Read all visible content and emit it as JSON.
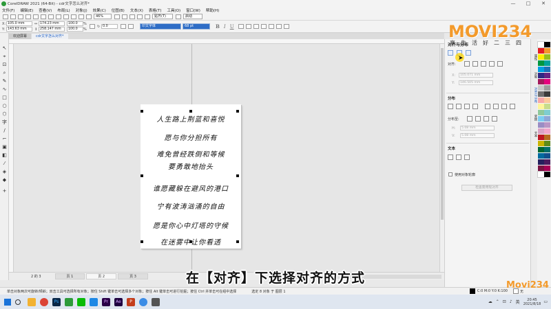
{
  "window": {
    "title": "CorelDRAW 2021 (64-Bit) - cdr文字怎么对齐*",
    "controls": [
      "—",
      "□",
      "✕"
    ]
  },
  "menu": [
    "文件(F)",
    "编辑(E)",
    "查看(V)",
    "布局(L)",
    "对象(J)",
    "效果(C)",
    "位图(B)",
    "文本(X)",
    "表格(T)",
    "工具(O)",
    "窗口(W)",
    "帮助(H)"
  ],
  "toolbar": {
    "zoom": "46%",
    "snap": "贴齐(T)",
    "launch": "启动"
  },
  "propbar": {
    "x": "105.0 mm",
    "y": "143.63 mm",
    "w": "174.23 mm",
    "h": "258.147 mm",
    "sx": "100.0",
    "sy": "100.0",
    "pct": "%",
    "angle": "0.0",
    "font": "印文字体",
    "size": "68 pt",
    "bold": "B",
    "italic": "I",
    "underline": "U"
  },
  "tabs": {
    "welcome": "欢迎屏幕",
    "doc": "cdr文字怎么对齐*"
  },
  "poem": [
    "人生路上荆蓝和喜悦",
    "愿与你分担所有",
    "难免曾经跌倒和等候",
    "要勇敢地抬头",
    "谁愿藏躲在避风的港口",
    "宁有波涛汹涌的自由",
    "愿是你心中灯塔的守候",
    "在迷雾中让你看透"
  ],
  "pages": {
    "counter": "2 的 3",
    "tabs": [
      "页 1",
      "页 2",
      "页 3"
    ],
    "active_index": 1
  },
  "status": {
    "hint": "单击对象两次可旋转/倾斜；双击工具可选择所有对象；按住 Shift 键单击可选择多个对象；按住 Alt 键单击可进行挖掘；按住 Ctrl 并单击可在组中选择",
    "selection": "选定 8 对象 于 图层 1",
    "fill": "C:0 M:0 Y:0 K:100",
    "outline": "无"
  },
  "docker": {
    "title": "对齐与分布",
    "align_to": "对齐:",
    "x_val": "105.071 mm",
    "y_val": "146.505 mm",
    "distribute": "分布",
    "distribute_to": "分布至:",
    "h_val": "5.08 mm",
    "v_val": "5.08 mm",
    "text_section": "文本",
    "use_bbox": "使用对象轮廓",
    "apply_button": "检查需用现对齐"
  },
  "vtabs": [
    "属性",
    "对象",
    "对齐与分布",
    "变换",
    "文本"
  ],
  "palette_colors": [
    "#ffffff",
    "#000000",
    "#e31e24",
    "#f39a2b",
    "#ffed00",
    "#95c11f",
    "#009640",
    "#00a19a",
    "#009fe3",
    "#1d71b8",
    "#312783",
    "#662483",
    "#a3195b",
    "#e6007e",
    "#c8c8c8",
    "#9d9d9c",
    "#706f6f",
    "#3c3c3b",
    "#f7a9a8",
    "#fbc99b",
    "#fff59b",
    "#c7dc8d",
    "#8fc99c",
    "#7fcdd0",
    "#7dcdf2",
    "#8fa8d7",
    "#9a8dc4",
    "#b996c5",
    "#d9a3c5",
    "#f2a7cc",
    "#be1622",
    "#b66a1f",
    "#c9b400",
    "#5e8b1a",
    "#006633",
    "#006e6a",
    "#006a9e",
    "#124f8c",
    "#25205e",
    "#4b1b5e",
    "#7a1443",
    "#a80056",
    "#ffffff",
    "#000000"
  ],
  "taskbar": {
    "clock_time": "20:45",
    "clock_date": "2021/8/18",
    "lang": "英"
  },
  "subtitle": "在【对齐】下选择对齐的方式",
  "watermark": {
    "logo": "MOVI234",
    "tagline": "享生活好二三四",
    "corner": "Movi234"
  }
}
